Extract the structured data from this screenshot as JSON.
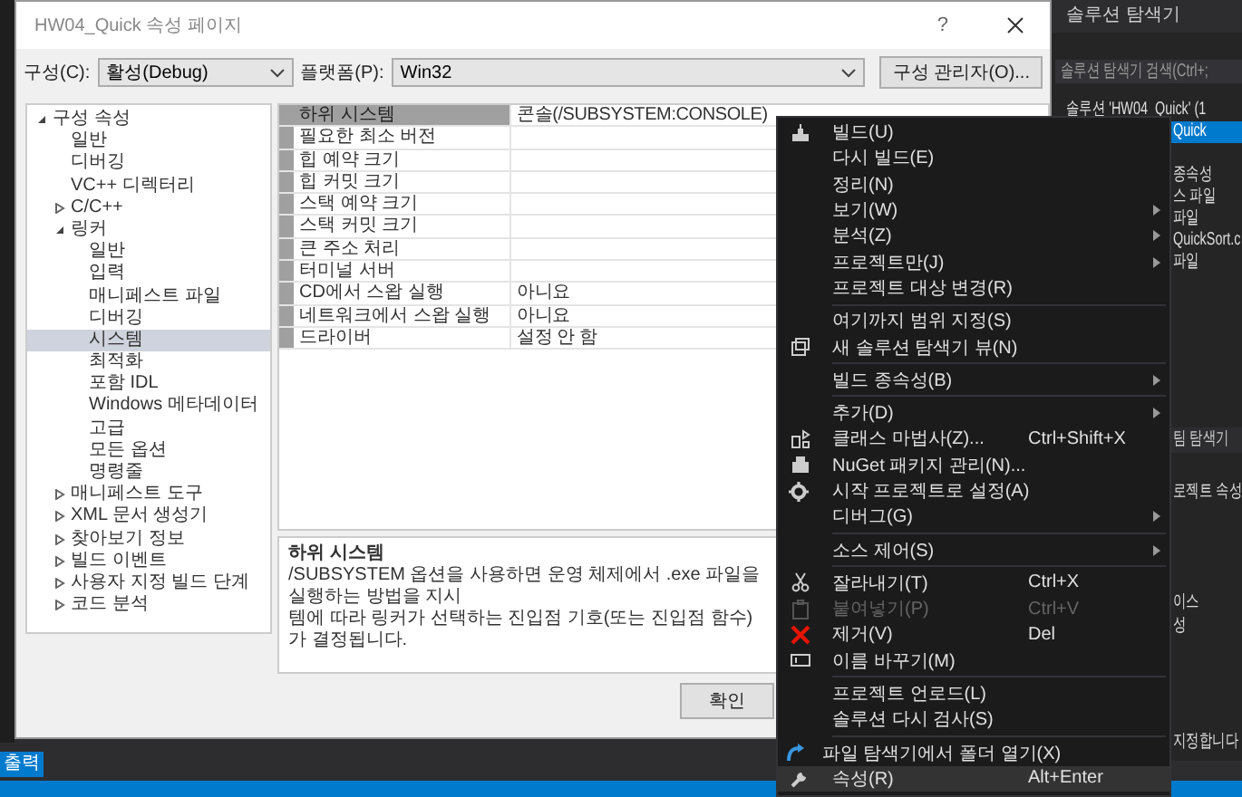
{
  "dialog": {
    "title": "HW04_Quick 속성 페이지",
    "help_button": "?",
    "config_label": "구성(C):",
    "config_value": "활성(Debug)",
    "platform_label": "플랫폼(P):",
    "platform_value": "Win32",
    "config_manager_button": "구성 관리자(O)...",
    "tree": [
      {
        "label": "구성 속성",
        "selected": false,
        "expanded": true,
        "children": [
          {
            "label": "일반",
            "selected": false
          },
          {
            "label": "디버깅",
            "selected": false
          },
          {
            "label": "VC++ 디렉터리",
            "selected": false
          },
          {
            "label": "C/C++",
            "selected": false,
            "expanded": false
          },
          {
            "label": "링커",
            "selected": false,
            "expanded": true,
            "children": [
              {
                "label": "일반",
                "selected": false
              },
              {
                "label": "입력",
                "selected": false
              },
              {
                "label": "매니페스트 파일",
                "selected": false
              },
              {
                "label": "디버깅",
                "selected": false
              },
              {
                "label": "시스템",
                "selected": true
              },
              {
                "label": "최적화",
                "selected": false
              },
              {
                "label": "포함 IDL",
                "selected": false
              },
              {
                "label": "Windows 메타데이터",
                "selected": false
              },
              {
                "label": "고급",
                "selected": false
              },
              {
                "label": "모든 옵션",
                "selected": false
              },
              {
                "label": "명령줄",
                "selected": false
              }
            ]
          },
          {
            "label": "매니페스트 도구",
            "selected": false,
            "expanded": false
          },
          {
            "label": "XML 문서 생성기",
            "selected": false,
            "expanded": false
          },
          {
            "label": "찾아보기 정보",
            "selected": false,
            "expanded": false
          },
          {
            "label": "빌드 이벤트",
            "selected": false,
            "expanded": false
          },
          {
            "label": "사용자 지정 빌드 단계",
            "selected": false,
            "expanded": false
          },
          {
            "label": "코드 분석",
            "selected": false,
            "expanded": false
          }
        ]
      }
    ],
    "properties": [
      {
        "name": "하위 시스템",
        "value": "콘솔(/SUBSYSTEM:CONSOLE)",
        "selected": true
      },
      {
        "name": "필요한 최소 버전",
        "selected": false
      },
      {
        "name": "힙 예약 크기",
        "selected": false
      },
      {
        "name": "힙 커밋 크기",
        "selected": false
      },
      {
        "name": "스택 예약 크기",
        "selected": false
      },
      {
        "name": "스택 커밋 크기",
        "selected": false
      },
      {
        "name": "큰 주소 처리",
        "selected": false
      },
      {
        "name": "터미널 서버",
        "selected": false
      },
      {
        "name": "CD에서 스왑 실행",
        "value": "아니요",
        "selected": false
      },
      {
        "name": "네트워크에서 스왑 실행",
        "value": "아니요",
        "selected": false
      },
      {
        "name": "드라이버",
        "value": "설정 안 함",
        "selected": false
      }
    ],
    "description_title": "하위 시스템",
    "description_lines": [
      "/SUBSYSTEM 옵션을 사용하면 운영 체제에서 .exe 파일을 실행하는 방법을 지시",
      "템에 따라 링커가 선택하는 진입점 기호(또는 진입점 함수)가 결정됩니다."
    ],
    "ok_button": "확인"
  },
  "solution_explorer": {
    "title": "솔루션 탐색기",
    "search_placeholder": "솔루션 탐색기 검색(Ctrl+;",
    "items": [
      {
        "label": "솔루션 'HW04_Quick' (1",
        "selected": false
      },
      {
        "label": "Quick",
        "selected": true
      },
      {
        "label": "종속성",
        "selected": false
      },
      {
        "label": "스 파일",
        "selected": false
      },
      {
        "label": "파일",
        "selected": false
      },
      {
        "label": "QuickSort.c",
        "selected": false
      },
      {
        "label": "파일",
        "selected": false
      }
    ],
    "team_tab": "팀 탐색기",
    "properties_title": "로젝트 속성",
    "property_rows": [
      "이스",
      "성"
    ],
    "hint": "지정합니다"
  },
  "output_tab": "출력",
  "context_menu": [
    {
      "kind": "item",
      "label": "빌드(U)",
      "submenu": false,
      "disabled": false,
      "selected": false
    },
    {
      "kind": "item",
      "label": "다시 빌드(E)",
      "submenu": false,
      "disabled": false,
      "selected": false
    },
    {
      "kind": "item",
      "label": "정리(N)",
      "submenu": false,
      "disabled": false,
      "selected": false
    },
    {
      "kind": "item",
      "label": "보기(W)",
      "submenu": true,
      "disabled": false,
      "selected": false
    },
    {
      "kind": "item",
      "label": "분석(Z)",
      "submenu": true,
      "disabled": false,
      "selected": false
    },
    {
      "kind": "item",
      "label": "프로젝트만(J)",
      "submenu": true,
      "disabled": false,
      "selected": false
    },
    {
      "kind": "item",
      "label": "프로젝트 대상 변경(R)",
      "submenu": false,
      "disabled": false,
      "selected": false
    },
    {
      "kind": "separator"
    },
    {
      "kind": "item",
      "label": "여기까지 범위 지정(S)",
      "submenu": false,
      "disabled": false,
      "selected": false
    },
    {
      "kind": "item",
      "label": "새 솔루션 탐색기 뷰(N)",
      "submenu": false,
      "disabled": false,
      "selected": false
    },
    {
      "kind": "separator"
    },
    {
      "kind": "item",
      "label": "빌드 종속성(B)",
      "submenu": true,
      "disabled": false,
      "selected": false
    },
    {
      "kind": "separator"
    },
    {
      "kind": "item",
      "label": "추가(D)",
      "submenu": true,
      "disabled": false,
      "selected": false
    },
    {
      "kind": "item",
      "label": "클래스 마법사(Z)...",
      "shortcut": "Ctrl+Shift+X",
      "submenu": false,
      "disabled": false,
      "selected": false
    },
    {
      "kind": "item",
      "label": "NuGet 패키지 관리(N)...",
      "submenu": false,
      "disabled": false,
      "selected": false
    },
    {
      "kind": "item",
      "label": "시작 프로젝트로 설정(A)",
      "submenu": false,
      "disabled": false,
      "selected": false
    },
    {
      "kind": "item",
      "label": "디버그(G)",
      "submenu": true,
      "disabled": false,
      "selected": false
    },
    {
      "kind": "separator"
    },
    {
      "kind": "item",
      "label": "소스 제어(S)",
      "submenu": true,
      "disabled": false,
      "selected": false
    },
    {
      "kind": "separator"
    },
    {
      "kind": "item",
      "label": "잘라내기(T)",
      "shortcut": "Ctrl+X",
      "submenu": false,
      "disabled": false,
      "selected": false
    },
    {
      "kind": "item",
      "label": "붙여넣기(P)",
      "shortcut": "Ctrl+V",
      "submenu": false,
      "disabled": true,
      "selected": false
    },
    {
      "kind": "item",
      "label": "제거(V)",
      "shortcut": "Del",
      "submenu": false,
      "disabled": false,
      "selected": false
    },
    {
      "kind": "item",
      "label": "이름 바꾸기(M)",
      "submenu": false,
      "disabled": false,
      "selected": false
    },
    {
      "kind": "separator"
    },
    {
      "kind": "item",
      "label": "프로젝트 언로드(L)",
      "submenu": false,
      "disabled": false,
      "selected": false
    },
    {
      "kind": "item",
      "label": "솔루션 다시 검사(S)",
      "submenu": false,
      "disabled": false,
      "selected": false
    },
    {
      "kind": "separator"
    },
    {
      "kind": "item",
      "label": "파일 탐색기에서 폴더 열기(X)",
      "submenu": false,
      "disabled": false,
      "selected": false
    },
    {
      "kind": "item",
      "label": "속성(R)",
      "shortcut": "Alt+Enter",
      "submenu": false,
      "disabled": false,
      "selected": true
    }
  ]
}
